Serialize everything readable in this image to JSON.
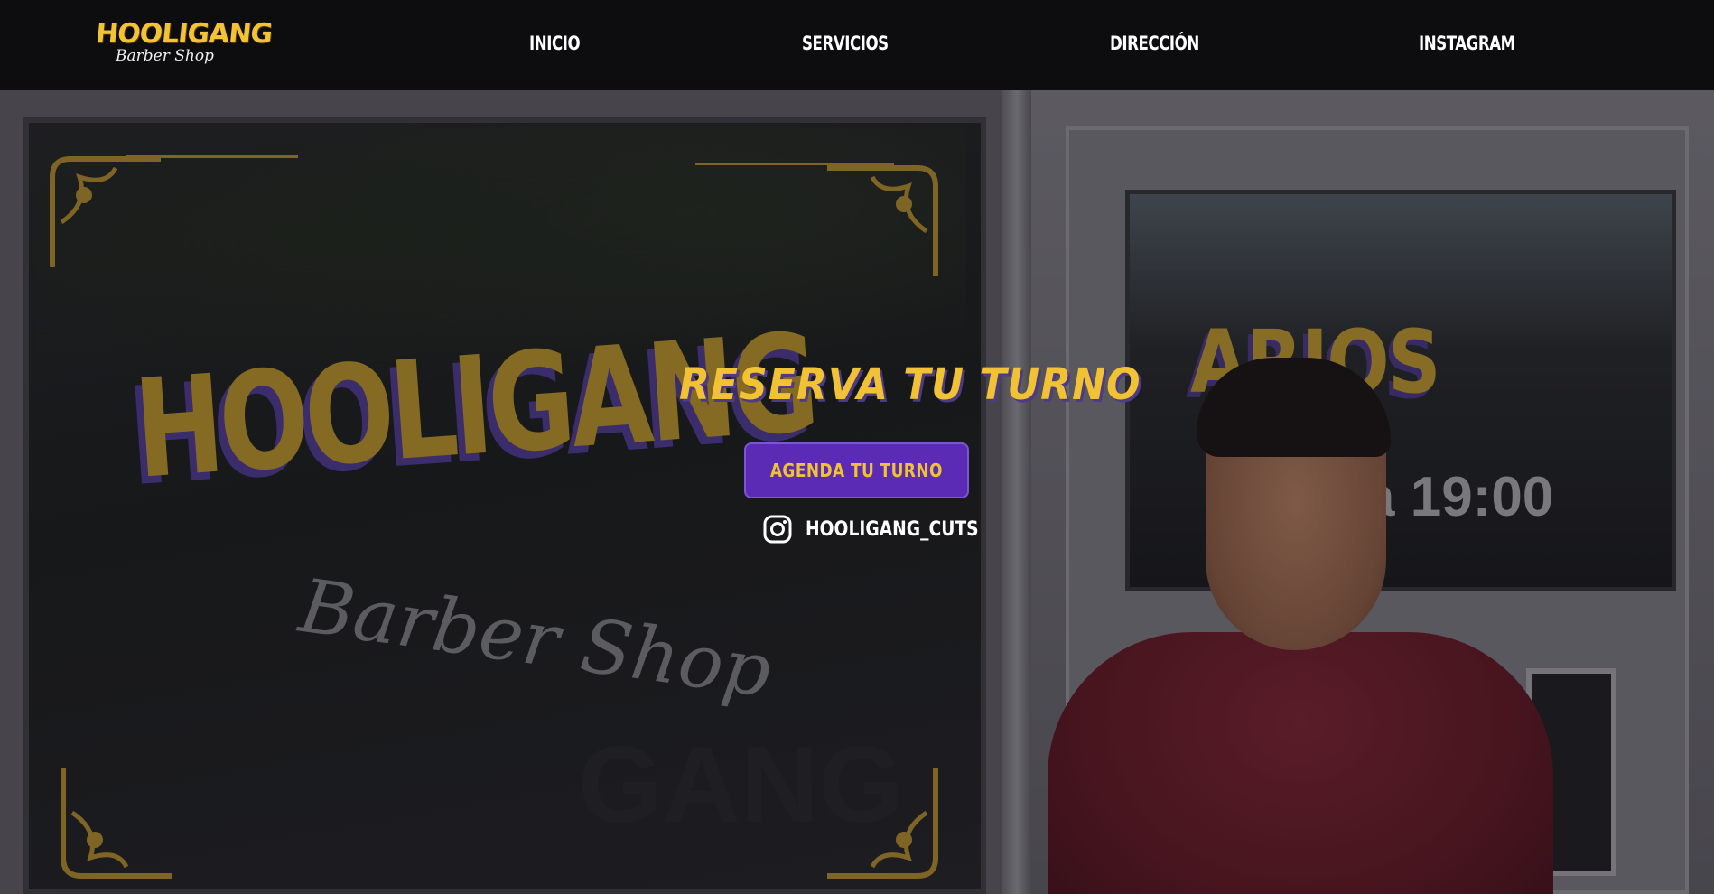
{
  "brand": {
    "logo_top": "HOOLIGANG",
    "logo_bottom": "Barber Shop",
    "gold": "#f1c233",
    "purple": "#5b2bb5"
  },
  "nav": {
    "items": [
      {
        "label": "INICIO"
      },
      {
        "label": "SERVICIOS"
      },
      {
        "label": "DIRECCIÓN"
      },
      {
        "label": "INSTAGRAM"
      }
    ]
  },
  "hero": {
    "title": "RESERVA TU TURNO",
    "button_label": "AGENDA TU TURNO",
    "instagram_handle": "HOOLIGANG_CUTS",
    "instagram_icon": "instagram-icon",
    "background": {
      "window_decal_main": "HOOLIGANG",
      "window_decal_script": "Barber Shop",
      "window_decal_faint": "GANG",
      "door_sign_text": "ARIOS",
      "door_time_text": "a 19:00"
    }
  }
}
